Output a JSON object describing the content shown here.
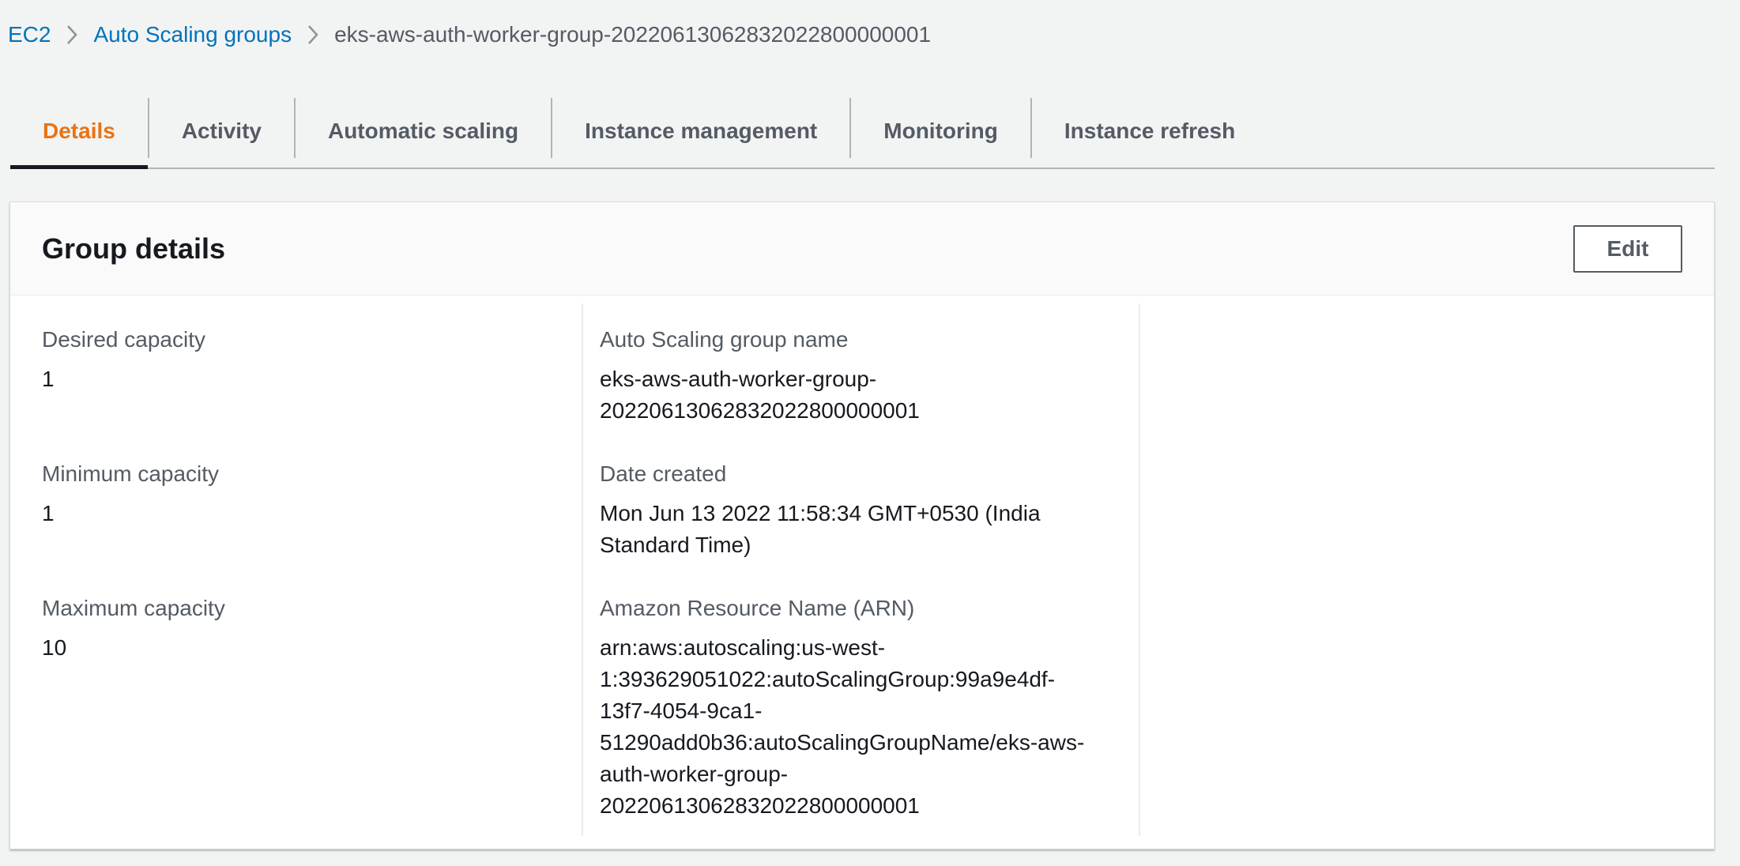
{
  "breadcrumb": {
    "items": [
      {
        "label": "EC2",
        "link": true
      },
      {
        "label": "Auto Scaling groups",
        "link": true
      },
      {
        "label": "eks-aws-auth-worker-group-20220613062832022800000001",
        "link": false
      }
    ]
  },
  "tabs": [
    {
      "label": "Details",
      "active": true
    },
    {
      "label": "Activity",
      "active": false
    },
    {
      "label": "Automatic scaling",
      "active": false
    },
    {
      "label": "Instance management",
      "active": false
    },
    {
      "label": "Monitoring",
      "active": false
    },
    {
      "label": "Instance refresh",
      "active": false
    }
  ],
  "panel": {
    "title": "Group details",
    "edit_label": "Edit",
    "fields": {
      "desired_capacity": {
        "label": "Desired capacity",
        "value": "1"
      },
      "minimum_capacity": {
        "label": "Minimum capacity",
        "value": "1"
      },
      "maximum_capacity": {
        "label": "Maximum capacity",
        "value": "10"
      },
      "group_name": {
        "label": "Auto Scaling group name",
        "value_lines": [
          "eks-aws-auth-worker-group-",
          "20220613062832022800000001"
        ]
      },
      "date_created": {
        "label": "Date created",
        "value_lines": [
          "Mon Jun 13 2022 11:58:34 GMT+0530 (India",
          "Standard Time)"
        ]
      },
      "arn": {
        "label": "Amazon Resource Name (ARN)",
        "value_lines": [
          "arn:aws:autoscaling:us-west-",
          "1:393629051022:autoScalingGroup:99a9e4df-",
          "13f7-4054-9ca1-",
          "51290add0b36:autoScalingGroupName/eks-aws-",
          "auth-worker-group-",
          "20220613062832022800000001"
        ]
      }
    }
  },
  "colors": {
    "link": "#0073bb",
    "active_tab": "#ec7211",
    "text": "#16191f",
    "secondary_text": "#545b64",
    "background": "#f2f3f3"
  },
  "icons": {
    "breadcrumb_separator": "chevron-right-icon"
  }
}
